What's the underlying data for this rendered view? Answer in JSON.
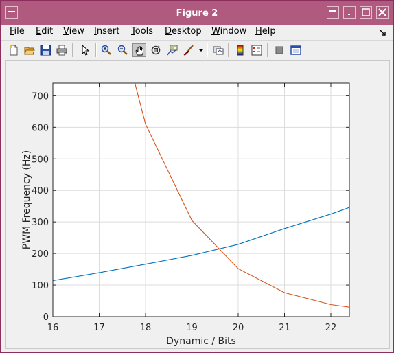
{
  "window": {
    "title": "Figure 2"
  },
  "menubar": {
    "items": [
      {
        "label": "File",
        "mnemonic": "F",
        "rest": "ile"
      },
      {
        "label": "Edit",
        "mnemonic": "E",
        "rest": "dit"
      },
      {
        "label": "View",
        "mnemonic": "V",
        "rest": "iew"
      },
      {
        "label": "Insert",
        "mnemonic": "I",
        "rest": "nsert"
      },
      {
        "label": "Tools",
        "mnemonic": "T",
        "rest": "ools"
      },
      {
        "label": "Desktop",
        "mnemonic": "D",
        "rest": "esktop"
      },
      {
        "label": "Window",
        "mnemonic": "W",
        "rest": "indow"
      },
      {
        "label": "Help",
        "mnemonic": "H",
        "rest": "elp"
      }
    ]
  },
  "toolbar": {
    "tools": [
      "new-figure-icon",
      "open-file-icon",
      "save-icon",
      "print-icon",
      "pointer-icon",
      "zoom-in-icon",
      "zoom-out-icon",
      "pan-hand-icon",
      "rotate-3d-icon",
      "data-cursor-icon",
      "brush-icon",
      "link-plot-icon",
      "colorbar-icon",
      "legend-icon",
      "hide-plot-tools-icon",
      "show-plot-tools-icon"
    ],
    "pressed": "pan-hand-icon"
  },
  "colors": {
    "series_blue": "#0072bd",
    "series_orange": "#d95319",
    "title_bar": "#b05a7f"
  },
  "chart_data": {
    "type": "line",
    "xlabel": "Dynamic / Bits",
    "ylabel": "PWM Frequency (Hz)",
    "xlim": [
      16,
      22.4
    ],
    "ylim": [
      0,
      740
    ],
    "xticks": [
      16,
      17,
      18,
      19,
      20,
      21,
      22
    ],
    "yticks": [
      0,
      100,
      200,
      300,
      400,
      500,
      600,
      700
    ],
    "grid": true,
    "series": [
      {
        "color": "#0072bd",
        "x": [
          16,
          17,
          18,
          19,
          20,
          21,
          22,
          22.4
        ],
        "y": [
          114,
          139,
          166,
          194,
          229,
          279,
          325,
          346
        ]
      },
      {
        "color": "#d95319",
        "x": [
          17.77,
          18,
          19,
          20,
          21,
          22,
          22.4
        ],
        "y": [
          740,
          610,
          305,
          152,
          76,
          38,
          30
        ]
      }
    ]
  }
}
